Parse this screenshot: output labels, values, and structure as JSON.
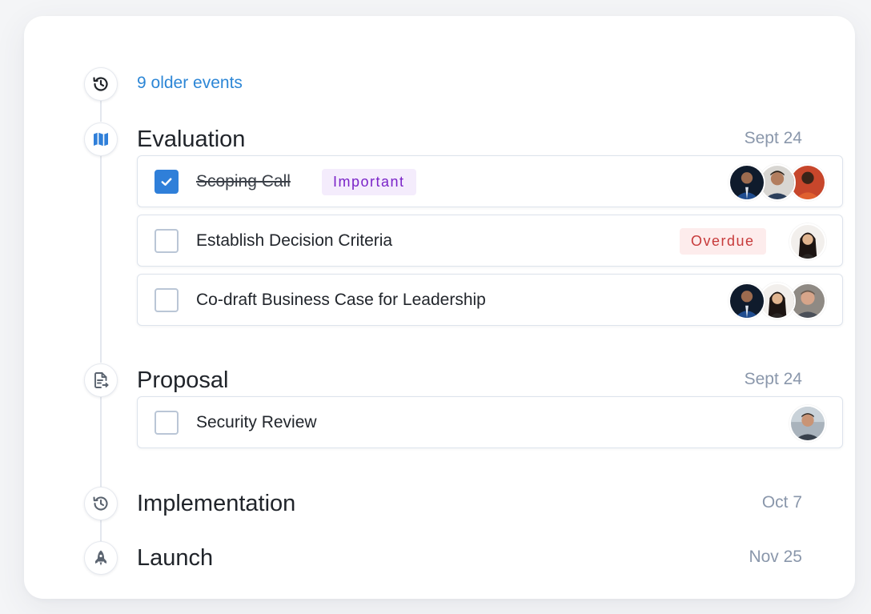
{
  "older_events": {
    "label": "9 older events"
  },
  "stages": [
    {
      "title": "Evaluation",
      "date": "Sept 24",
      "tasks": [
        {
          "label": "Scoping Call",
          "checked": true,
          "tag": "Important",
          "avatars": [
            "person-suit-blue",
            "person-smiling-man",
            "person-orange-shirt"
          ]
        },
        {
          "label": "Establish Decision Criteria",
          "checked": false,
          "tag": "Overdue",
          "avatars": [
            "person-woman-dark-hair"
          ]
        },
        {
          "label": "Co-draft Business Case for Leadership",
          "checked": false,
          "avatars": [
            "person-suit-blue",
            "person-woman-dark-hair",
            "person-bald-man"
          ]
        }
      ]
    },
    {
      "title": "Proposal",
      "date": "Sept 24",
      "tasks": [
        {
          "label": "Security Review",
          "checked": false,
          "avatars": [
            "person-man-outdoor"
          ]
        }
      ]
    },
    {
      "title": "Implementation",
      "date": "Oct 7",
      "tasks": []
    },
    {
      "title": "Launch",
      "date": "Nov 25",
      "tasks": []
    }
  ],
  "icons": {
    "older": "history-icon",
    "evaluation": "map-icon",
    "proposal": "document-export-icon",
    "implementation": "history-icon",
    "launch": "rocket-icon"
  },
  "colors": {
    "link": "#2c86d6",
    "check": "#2f7fd9",
    "important_bg": "#f4ecfc",
    "important_text": "#7a23c8",
    "overdue_bg": "#fdecec",
    "overdue_text": "#c73a3a",
    "date": "#8a97ab"
  }
}
